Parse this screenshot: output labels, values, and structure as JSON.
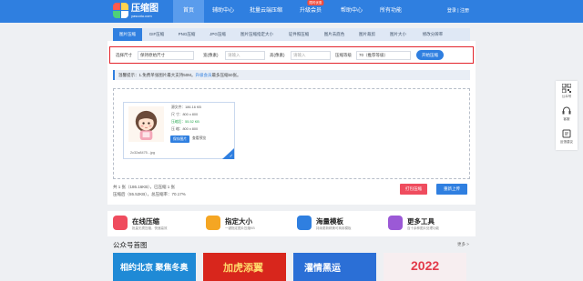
{
  "header": {
    "logo_title": "压缩图",
    "logo_sub": "yasuotu.com",
    "nav": [
      {
        "label": "首页",
        "active": true
      },
      {
        "label": "辅助中心",
        "active": false
      },
      {
        "label": "批量云端压缩",
        "active": false
      },
      {
        "label": "升级会员",
        "active": false,
        "badge": "限时优惠"
      },
      {
        "label": "帮助中心",
        "active": false
      },
      {
        "label": "所有功能",
        "active": false
      }
    ],
    "user_links": "登录 | 注册"
  },
  "tool_tabs": [
    "图片压缩",
    "GIF压缩",
    "PNG压缩",
    "JPG压缩",
    "图片压缩指定大小",
    "证件照压缩",
    "图片去底色",
    "图片裁剪",
    "图片大小",
    "修改分辨率"
  ],
  "options": {
    "size_label": "选择尺寸",
    "size_value": "保持原始尺寸",
    "width_label": "宽(像素)",
    "width_placeholder": "请输入",
    "height_label": "高(像素)",
    "height_placeholder": "请输入",
    "quality_label": "压缩等级",
    "quality_value": "70（推荐等级）",
    "start_button": "开始压缩"
  },
  "notice": {
    "text": "温馨提示：1.免费单张图片最大支持50M。",
    "link": "升级会员",
    "tail": "最多压缩60张。"
  },
  "result": {
    "source_line": "源文件：186.16 KB",
    "source_dim": "尺 寸：800 x 800",
    "compressed_line": "压缩后：55.52 KB",
    "compressed_dim": "压 缩：800 x 800",
    "save_button": "保存图片",
    "view_link": "查看预览",
    "filename": "2c32a8475...jpg"
  },
  "stats": {
    "line1": "共 1 张（186.16KB），已压缩 1 张",
    "line2": "压缩后（55.52KB），总压缩率：70.17%"
  },
  "buttons": {
    "pack": "打包压缩",
    "reupload": "重新上传"
  },
  "features": [
    {
      "title": "在线压缩",
      "desc": "批量无损压缩，快速高效",
      "icon": "compress-icon",
      "color": "#ef4c5e"
    },
    {
      "title": "指定大小",
      "desc": "一键指定图片压缩KB",
      "icon": "target-size-icon",
      "color": "#f5a623"
    },
    {
      "title": "海量模板",
      "desc": "持续更新精美可商用模板",
      "icon": "template-icon",
      "color": "#2f7fe0"
    },
    {
      "title": "更多工具",
      "desc": "百十余种图片处理功能",
      "icon": "tools-icon",
      "color": "#9b59d6"
    }
  ],
  "section": {
    "title": "公众号首图",
    "more": "更多 >"
  },
  "posters": [
    {
      "text": "相约北京 聚焦冬奥",
      "bg": "#1f8ad6",
      "fg": "#fff"
    },
    {
      "text": "加虎添翼",
      "bg": "#d8261c",
      "fg": "#ffd86b"
    },
    {
      "text": "灌情黑运",
      "bg": "#2b6fd6",
      "fg": "#fff"
    },
    {
      "text": "2022",
      "bg": "#f7eef0",
      "fg": "#e33b4b"
    }
  ],
  "sidebar": [
    {
      "label": "公众号",
      "icon": "qrcode-icon"
    },
    {
      "label": "客服",
      "icon": "headset-icon"
    },
    {
      "label": "反馈建议",
      "icon": "feedback-icon"
    }
  ]
}
